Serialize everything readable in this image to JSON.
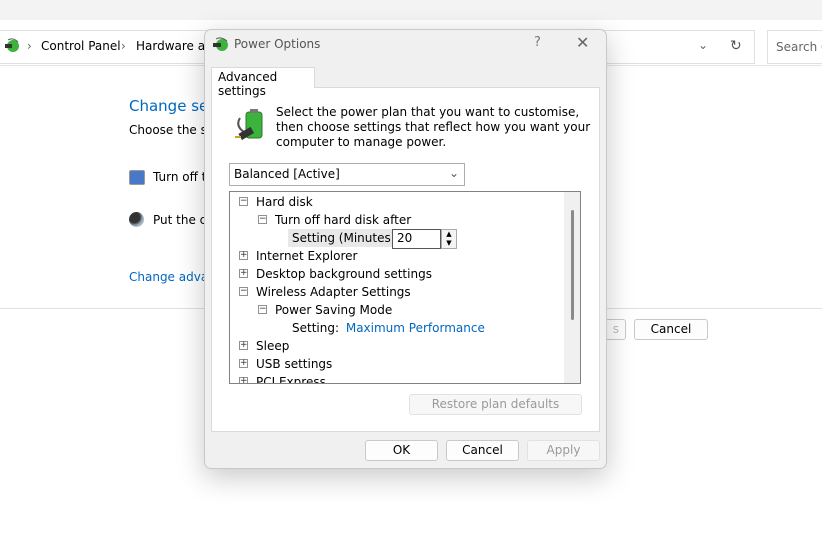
{
  "background_window": {
    "breadcrumb": [
      "Control Panel",
      "Hardware an"
    ],
    "search_placeholder": "Search C",
    "heading": "Change set",
    "subtitle": "Choose the sle",
    "option_display": "Turn off t",
    "option_sleep": "Put the co",
    "link_advanced": "Change advan",
    "save_button_partial": "s",
    "cancel_button": "Cancel"
  },
  "dialog": {
    "title": "Power Options",
    "help": "?",
    "tab": "Advanced settings",
    "description": "Select the power plan that you want to customise, then choose settings that reflect how you want your computer to manage power.",
    "plan_select": "Balanced [Active]",
    "tree": [
      {
        "label": "Hard disk",
        "toggle": "−",
        "level": 0
      },
      {
        "label": "Turn off hard disk after",
        "toggle": "−",
        "level": 1
      },
      {
        "label": "Setting (Minutes):",
        "value": "20",
        "level": 2,
        "type": "spinner"
      },
      {
        "label": "Internet Explorer",
        "toggle": "+",
        "level": 0
      },
      {
        "label": "Desktop background settings",
        "toggle": "+",
        "level": 0
      },
      {
        "label": "Wireless Adapter Settings",
        "toggle": "−",
        "level": 0
      },
      {
        "label": "Power Saving Mode",
        "toggle": "−",
        "level": 1
      },
      {
        "label": "Setting:",
        "value": "Maximum Performance",
        "level": 2,
        "type": "link"
      },
      {
        "label": "Sleep",
        "toggle": "+",
        "level": 0
      },
      {
        "label": "USB settings",
        "toggle": "+",
        "level": 0
      },
      {
        "label": "PCI Express",
        "toggle": "+",
        "level": 0
      }
    ],
    "restore_button": "Restore plan defaults",
    "ok_button": "OK",
    "cancel_button": "Cancel",
    "apply_button": "Apply"
  },
  "colors": {
    "link": "#0067c0",
    "battery": "#3cb33c"
  }
}
